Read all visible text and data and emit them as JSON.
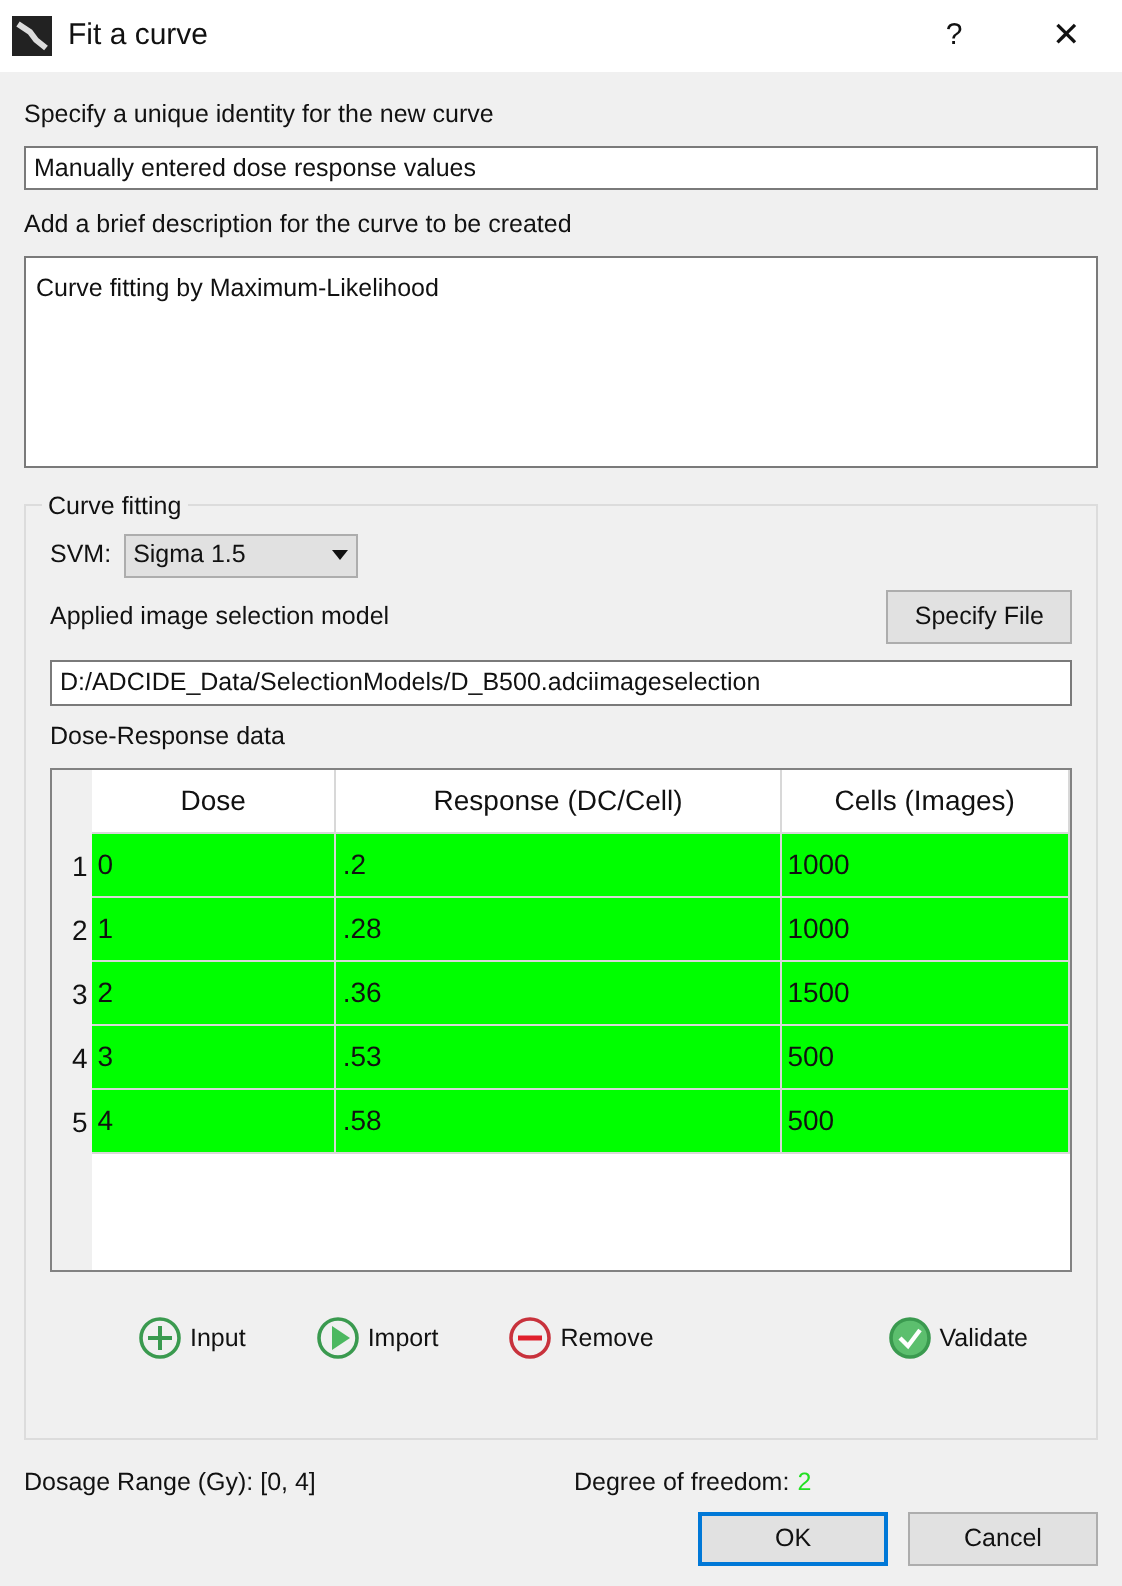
{
  "window": {
    "title": "Fit a curve",
    "help": "?",
    "close": "✕"
  },
  "identity": {
    "label": "Specify a unique identity for the new curve",
    "value": "Manually entered dose response values"
  },
  "description": {
    "label": "Add a brief description for the curve to be created",
    "value": "Curve fitting by Maximum-Likelihood"
  },
  "curve_fitting": {
    "title": "Curve fitting",
    "svm": {
      "label": "SVM:",
      "value": "Sigma 1.5"
    },
    "model": {
      "label": "Applied image selection model",
      "button": "Specify File",
      "value": "D:/ADCIDE_Data/SelectionModels/D_B500.adciimageselection"
    },
    "table": {
      "label": "Dose-Response data",
      "columns": [
        "Dose",
        "Response (DC/Cell)",
        "Cells (Images)"
      ],
      "rows": [
        {
          "index": "1",
          "cells": [
            "0",
            ".2",
            "1000"
          ],
          "valid": true
        },
        {
          "index": "2",
          "cells": [
            "1",
            ".28",
            "1000"
          ],
          "valid": true
        },
        {
          "index": "3",
          "cells": [
            "2",
            ".36",
            "1500"
          ],
          "valid": true
        },
        {
          "index": "4",
          "cells": [
            "3",
            ".53",
            "500"
          ],
          "valid": true
        },
        {
          "index": "5",
          "cells": [
            "4",
            ".58",
            "500"
          ],
          "valid": true
        }
      ]
    },
    "actions": [
      {
        "kind": "add",
        "label": "Input"
      },
      {
        "kind": "play",
        "label": "Import"
      },
      {
        "kind": "remove",
        "label": "Remove"
      },
      {
        "kind": "check",
        "label": "Validate"
      }
    ]
  },
  "status": {
    "range": "Dosage Range (Gy): [0, 4]",
    "dof_label": "Degree of freedom:",
    "dof_value": "2"
  },
  "buttons": [
    {
      "label": "OK",
      "default": true
    },
    {
      "label": "Cancel",
      "default": false
    }
  ]
}
